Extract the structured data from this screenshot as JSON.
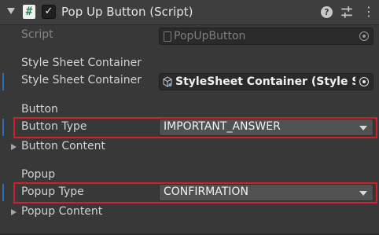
{
  "component": {
    "title": "Pop Up Button (Script)",
    "enabled": true,
    "icons": {
      "fold": "chevron-down-icon",
      "script": "script-hash-icon",
      "help": "help-icon",
      "presets": "presets-sliders-icon",
      "menu": "kebab-menu-icon"
    }
  },
  "fields": {
    "script": {
      "label": "Script",
      "value": "PopUpButton"
    },
    "style_sheet_section": {
      "label": "Style Sheet Container"
    },
    "style_sheet": {
      "label": "Style Sheet Container",
      "value": "StyleSheet Container (Style She"
    },
    "button_section": {
      "label": "Button"
    },
    "button_type": {
      "label": "Button Type",
      "value": "IMPORTANT_ANSWER"
    },
    "button_content": {
      "label": "Button Content"
    },
    "popup_section": {
      "label": "Popup"
    },
    "popup_type": {
      "label": "Popup Type",
      "value": "CONFIRMATION"
    },
    "popup_content": {
      "label": "Popup Content"
    }
  },
  "colors": {
    "background": "#383838",
    "header": "#3e3e3e",
    "field": "#2a2a2a",
    "dropdown": "#515151",
    "highlight": "#d21f2b",
    "accent_bar": "#2e6db0"
  }
}
